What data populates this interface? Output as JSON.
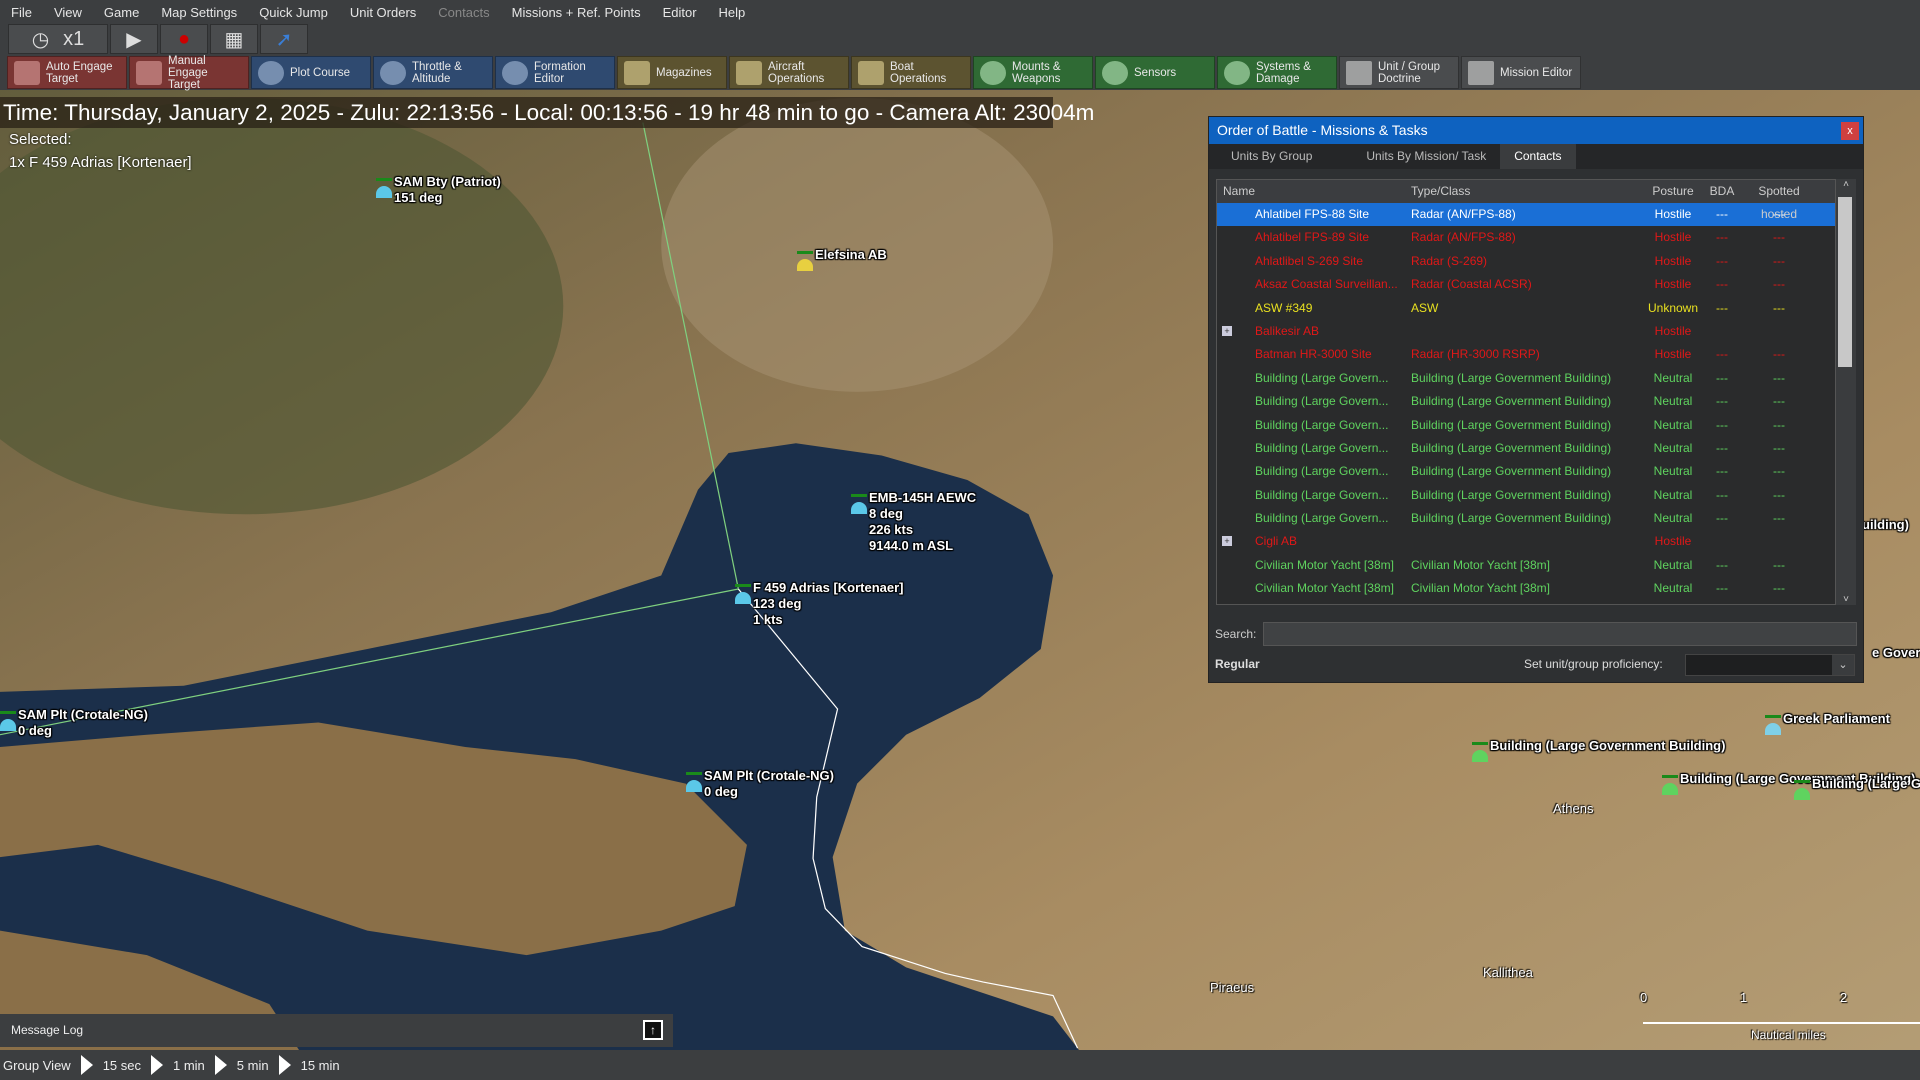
{
  "menu": [
    "File",
    "View",
    "Game",
    "Map Settings",
    "Quick Jump",
    "Unit Orders",
    "Contacts",
    "Missions + Ref. Points",
    "Editor",
    "Help"
  ],
  "sim": {
    "speed": "x1"
  },
  "toolbar": [
    {
      "label": "Auto Engage Target",
      "color": "red"
    },
    {
      "label": "Manual Engage Target",
      "color": "red"
    },
    {
      "label": "Plot Course",
      "color": "blue"
    },
    {
      "label": "Throttle & Altitude",
      "color": "blue"
    },
    {
      "label": "Formation Editor",
      "color": "blue"
    },
    {
      "label": "Magazines",
      "color": "olive"
    },
    {
      "label": "Aircraft Operations",
      "color": "olive"
    },
    {
      "label": "Boat Operations",
      "color": "olive"
    },
    {
      "label": "Mounts & Weapons",
      "color": "green"
    },
    {
      "label": "Sensors",
      "color": "green"
    },
    {
      "label": "Systems & Damage",
      "color": "green"
    },
    {
      "label": "Unit / Group Doctrine",
      "color": "grey"
    },
    {
      "label": "Mission Editor",
      "color": "grey"
    }
  ],
  "time_text": "Time: Thursday, January 2, 2025 - Zulu: 22:13:56 - Local: 00:13:56 - 19 hr 48 min to go -  Camera Alt: 23004m",
  "selected": {
    "label": "Selected:",
    "unit": "1x F 459 Adrias [Kortenaer]"
  },
  "map_units": [
    {
      "lines": [
        "SAM Bty (Patriot)",
        "151 deg"
      ]
    },
    {
      "lines": [
        "Elefsina AB"
      ]
    },
    {
      "lines": [
        "EMB-145H AEWC",
        "8 deg",
        "226 kts",
        "9144.0 m ASL"
      ]
    },
    {
      "lines": [
        "F 459 Adrias [Kortenaer]",
        "123 deg",
        "1 kts"
      ]
    },
    {
      "lines": [
        "SAM Plt (Crotale-NG)",
        "0 deg"
      ]
    },
    {
      "lines": [
        "SAM Plt (Crotale-NG)",
        "0 deg"
      ]
    },
    {
      "lines": [
        "Greek Parliament"
      ]
    },
    {
      "lines": [
        "Building (Large Government Building)"
      ]
    },
    {
      "lines": [
        "Building (Large Government Building)"
      ]
    },
    {
      "lines": [
        "Building (Large Go"
      ]
    },
    {
      "lines": [
        "uilding)"
      ]
    },
    {
      "lines": [
        "e Governr"
      ]
    }
  ],
  "cities": [
    "Athens",
    "Piraeus",
    "Kallithea"
  ],
  "scale": {
    "ticks": [
      "0",
      "1",
      "2"
    ],
    "unit": "Nautical miles"
  },
  "dialog": {
    "title": "Order of Battle - Missions & Tasks",
    "close": "x",
    "tabs": [
      "Units By Group",
      "Units By Mission/ Task",
      "Contacts"
    ],
    "active_tab": "Contacts",
    "columns": [
      "Name",
      "Type/Class",
      "Posture",
      "BDA",
      "Spotted hosted"
    ],
    "colors": {
      "Hostile": "#e01818",
      "Unknown": "#e8e020",
      "Neutral": "#5fd35f"
    },
    "rows": [
      {
        "name": "Ahlatibel FPS-88 Site",
        "type": "Radar (AN/FPS-88)",
        "posture": "Hostile",
        "bda": "---",
        "spotted": "---",
        "selected": true
      },
      {
        "name": "Ahlatibel FPS-89 Site",
        "type": "Radar (AN/FPS-88)",
        "posture": "Hostile",
        "bda": "---",
        "spotted": "---"
      },
      {
        "name": "Ahlatlibel S-269 Site",
        "type": "Radar (S-269)",
        "posture": "Hostile",
        "bda": "---",
        "spotted": "---"
      },
      {
        "name": "Aksaz Coastal Surveillan...",
        "type": "Radar (Coastal ACSR)",
        "posture": "Hostile",
        "bda": "---",
        "spotted": "---"
      },
      {
        "name": "ASW #349",
        "type": "ASW",
        "posture": "Unknown",
        "bda": "---",
        "spotted": "---"
      },
      {
        "name": "Balikesir AB",
        "type": "",
        "posture": "Hostile",
        "bda": "",
        "spotted": "",
        "group": true
      },
      {
        "name": "Batman HR-3000 Site",
        "type": "Radar (HR-3000 RSRP)",
        "posture": "Hostile",
        "bda": "---",
        "spotted": "---"
      },
      {
        "name": "Building (Large Govern...",
        "type": "Building (Large Government Building)",
        "posture": "Neutral",
        "bda": "---",
        "spotted": "---"
      },
      {
        "name": "Building (Large Govern...",
        "type": "Building (Large Government Building)",
        "posture": "Neutral",
        "bda": "---",
        "spotted": "---"
      },
      {
        "name": "Building (Large Govern...",
        "type": "Building (Large Government Building)",
        "posture": "Neutral",
        "bda": "---",
        "spotted": "---"
      },
      {
        "name": "Building (Large Govern...",
        "type": "Building (Large Government Building)",
        "posture": "Neutral",
        "bda": "---",
        "spotted": "---"
      },
      {
        "name": "Building (Large Govern...",
        "type": "Building (Large Government Building)",
        "posture": "Neutral",
        "bda": "---",
        "spotted": "---"
      },
      {
        "name": "Building (Large Govern...",
        "type": "Building (Large Government Building)",
        "posture": "Neutral",
        "bda": "---",
        "spotted": "---"
      },
      {
        "name": "Building (Large Govern...",
        "type": "Building (Large Government Building)",
        "posture": "Neutral",
        "bda": "---",
        "spotted": "---"
      },
      {
        "name": "Cigli AB",
        "type": "",
        "posture": "Hostile",
        "bda": "",
        "spotted": "",
        "group": true
      },
      {
        "name": "Civilian Motor Yacht [38m]",
        "type": "Civilian Motor Yacht [38m]",
        "posture": "Neutral",
        "bda": "---",
        "spotted": "---"
      },
      {
        "name": "Civilian Motor Yacht [38m]",
        "type": "Civilian Motor Yacht [38m]",
        "posture": "Neutral",
        "bda": "---",
        "spotted": "---"
      }
    ],
    "search_label": "Search:",
    "search_value": "",
    "proficiency_current": "Regular",
    "proficiency_label": "Set unit/group proficiency:",
    "proficiency_value": ""
  },
  "message_log": "Message Log",
  "bottom": [
    "Group View",
    "15 sec",
    "1 min",
    "5 min",
    "15 min"
  ]
}
